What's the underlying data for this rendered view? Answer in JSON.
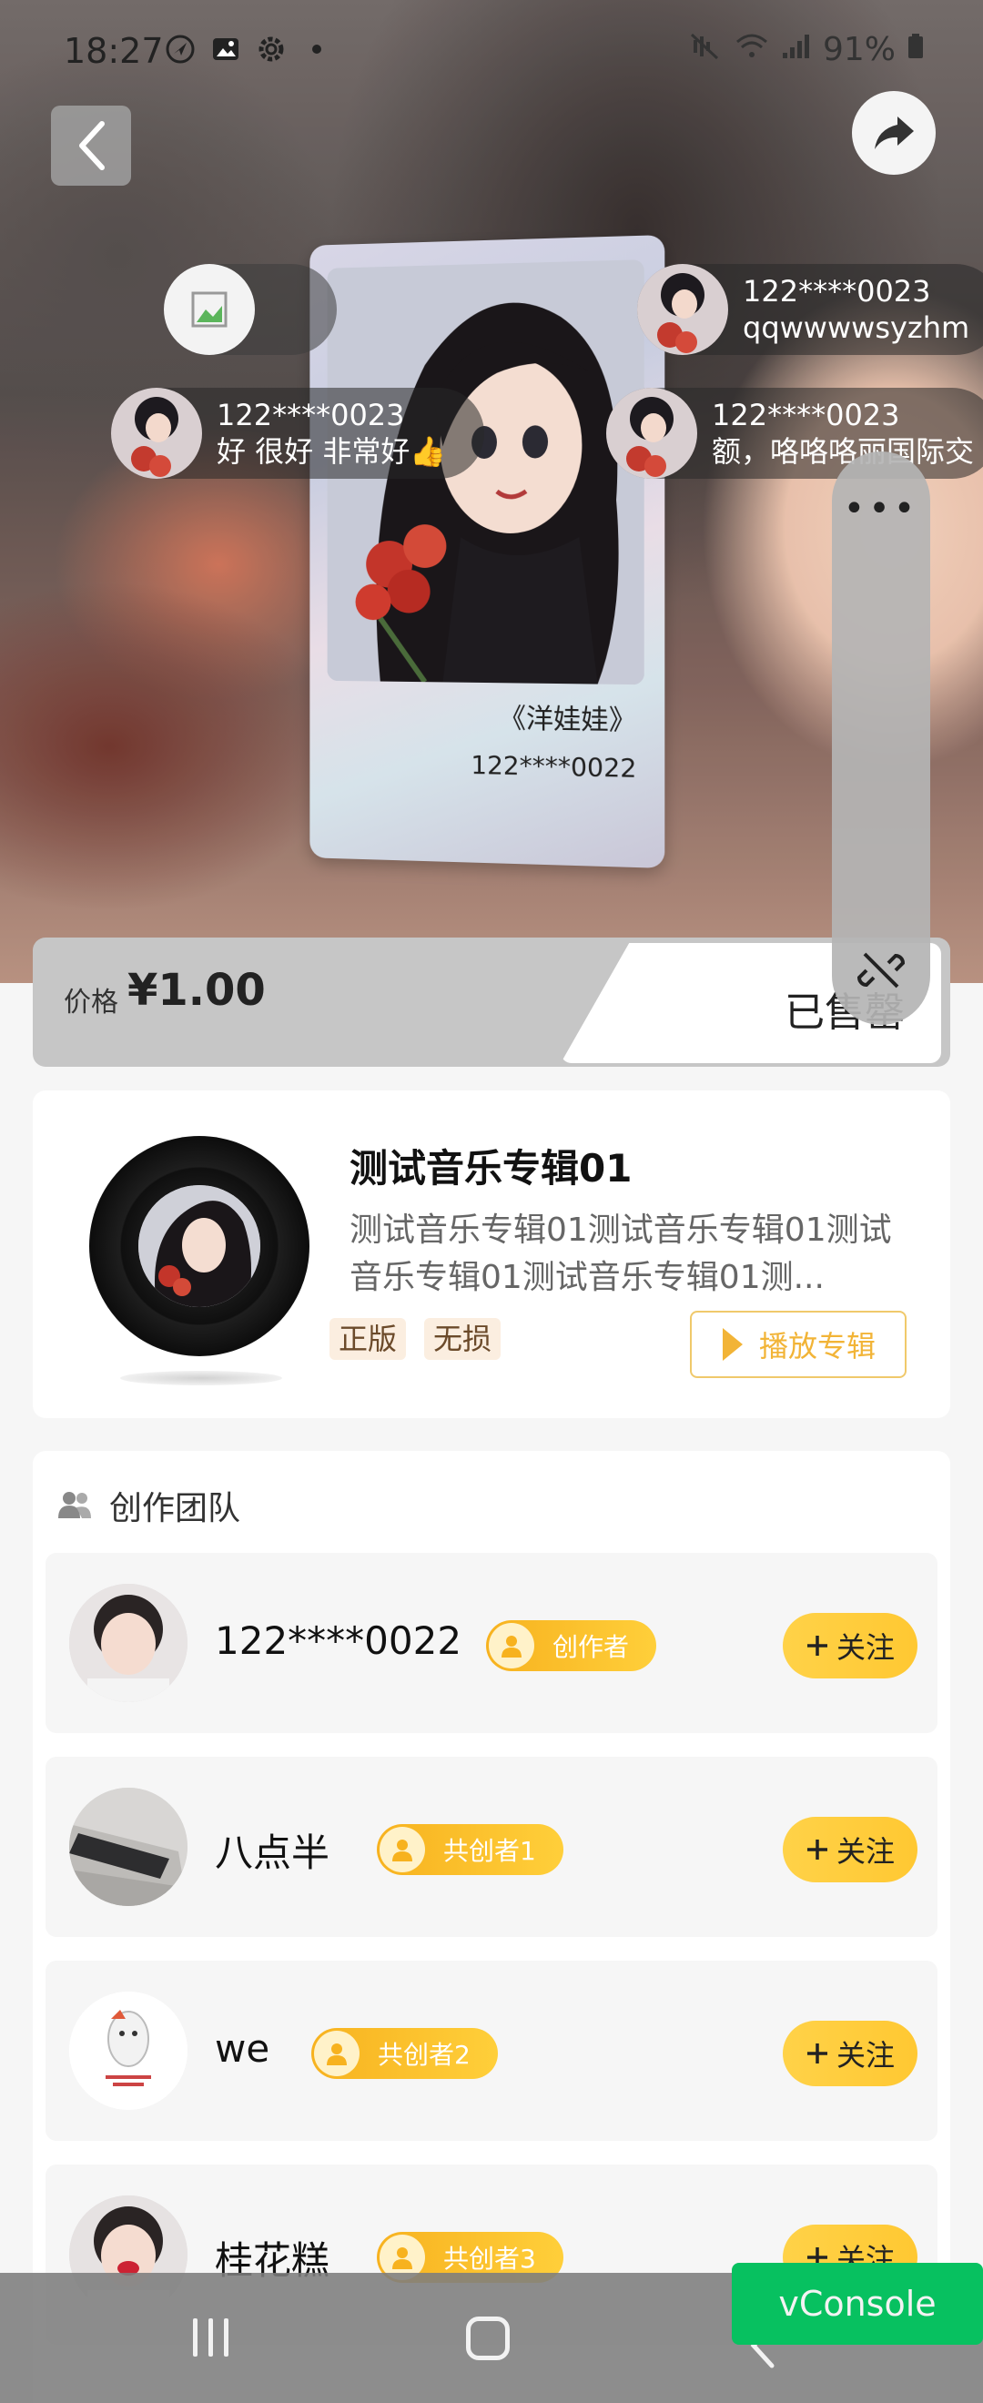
{
  "status_bar": {
    "time": "18:27",
    "battery": "91%"
  },
  "card": {
    "title": "《洋娃娃》",
    "owner": "122****0022"
  },
  "danmaku": [
    {
      "user": "122****0023",
      "text": "qqwwwwsyzhm"
    },
    {
      "user": "122****0023",
      "text": "好 很好 非常好👍"
    },
    {
      "user": "122****0023",
      "text": "额，咯咯咯丽国际交"
    }
  ],
  "float_menu": {
    "dots": "•••"
  },
  "price": {
    "label": "价格",
    "value": "¥1.00",
    "status": "已售罄"
  },
  "album": {
    "title": "测试音乐专辑01",
    "description": "测试音乐专辑01测试音乐专辑01测试音乐专辑01测试音乐专辑01测...",
    "tags": [
      "正版",
      "无损"
    ],
    "play_label": "播放专辑"
  },
  "team": {
    "heading": "创作团队",
    "members": [
      {
        "name": "122****0022",
        "role": "创作者",
        "follow": "关注"
      },
      {
        "name": "八点半",
        "role": "共创者1",
        "follow": "关注"
      },
      {
        "name": "we",
        "role": "共创者2",
        "follow": "关注"
      },
      {
        "name": "桂花糕",
        "role": "共创者3",
        "follow": "关注"
      }
    ]
  },
  "vconsole": "vConsole",
  "colors": {
    "accent_yellow": "#ffc832",
    "play_orange": "#f2b437",
    "vconsole_green": "#07c160"
  }
}
